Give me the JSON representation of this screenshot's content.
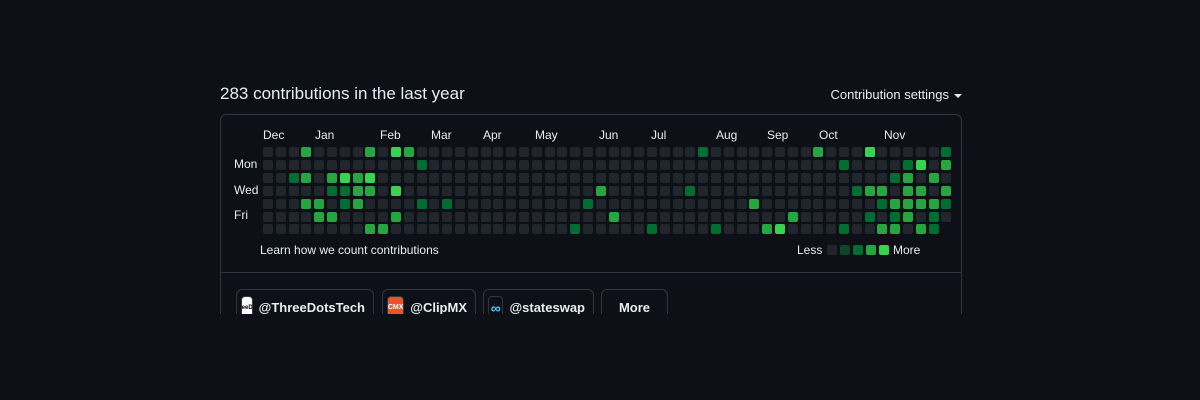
{
  "header": {
    "title": "283 contributions in the last year",
    "settings_label": "Contribution settings"
  },
  "calendar": {
    "months": [
      "Dec",
      "Jan",
      "Feb",
      "Mar",
      "Apr",
      "May",
      "Jun",
      "Jul",
      "Aug",
      "Sep",
      "Oct",
      "Nov"
    ],
    "day_labels": [
      "Mon",
      "Wed",
      "Fri"
    ],
    "colors": {
      "level0": "#21262d",
      "level1": "#0e4429",
      "level2": "#006d32",
      "level3": "#26a641",
      "level4": "#39d353"
    },
    "learn_link": "Learn how we count contributions",
    "legend_less": "Less",
    "legend_more": "More"
  },
  "organizations": [
    {
      "label": "@ThreeDotsTech",
      "avatar_text": "ThreeDots",
      "avatar_bg": "#ffffff",
      "avatar_fg": "#000000"
    },
    {
      "label": "@ClipMX",
      "avatar_text": "CMX",
      "avatar_bg": "#e8552c",
      "avatar_fg": "#ffffff"
    },
    {
      "label": "@stateswap",
      "avatar_text": "∞",
      "avatar_bg": "#0d1117",
      "avatar_fg": "#5ac8fa"
    }
  ],
  "more_button": "More"
}
